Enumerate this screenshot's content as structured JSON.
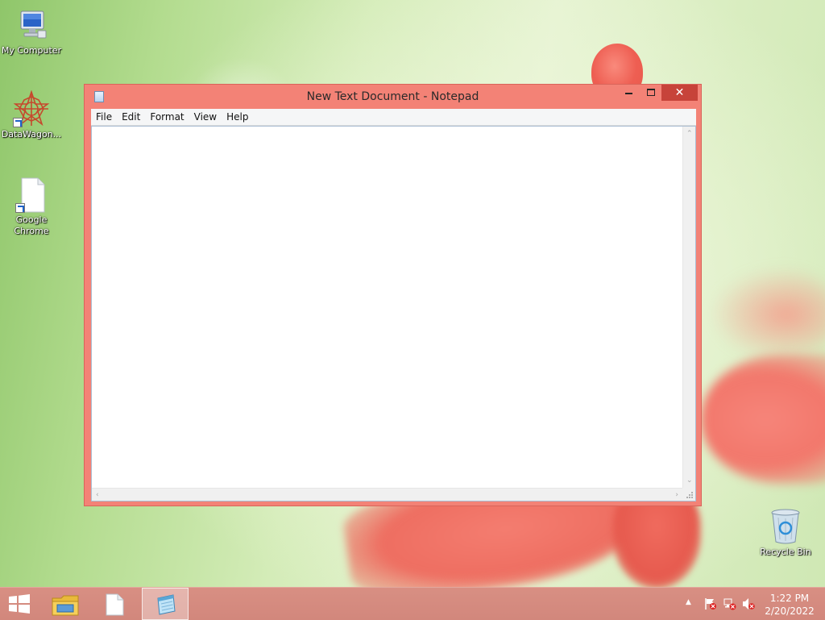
{
  "desktop": {
    "icons": [
      {
        "label": "My Computer",
        "icon": "computer-icon"
      },
      {
        "label": "DataWagon...",
        "icon": "datawagon-icon"
      },
      {
        "label": "Google Chrome",
        "icon": "document-icon"
      },
      {
        "label": "Recycle Bin",
        "icon": "recycle-bin-icon"
      }
    ]
  },
  "window": {
    "title": "New Text Document - Notepad",
    "close_glyph": "✕",
    "menu": [
      "File",
      "Edit",
      "Format",
      "View",
      "Help"
    ],
    "content": ""
  },
  "taskbar": {
    "items": [
      "start-icon",
      "file-explorer-icon",
      "document-icon",
      "notepad-icon"
    ],
    "tray": {
      "show_hidden_glyph": "▲",
      "time": "1:22 PM",
      "date": "2/20/2022"
    }
  },
  "colors": {
    "window_frame": "#f38276",
    "close_button": "#c7433a",
    "taskbar": "#d88f83",
    "desktop_green": "#b3dc8f"
  }
}
